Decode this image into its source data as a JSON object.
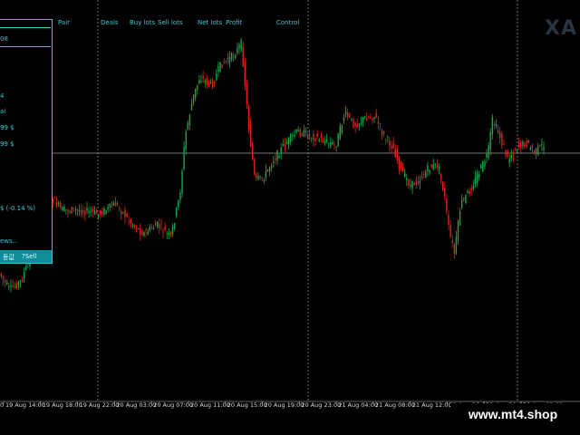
{
  "chart": {
    "symbol_partial": "XA",
    "time_axis": [
      "19 Aug 14:00",
      "19 Aug 18:00",
      "19 Aug 22:00",
      "20 Aug 03:00",
      "20 Aug 07:00",
      "20 Aug 11:00",
      "20 Aug 15:00",
      "20 Aug 19:00",
      "20 Aug 23:00",
      "21 Aug 04:00",
      "21 Aug 08:00",
      "21 Aug 12:00",
      "21 Aug 16:00",
      "21 Aug 20:00",
      "22 Aug 01:00"
    ],
    "first_axis_label_partial": "0",
    "colors": {
      "bull": "#19a84a",
      "bear": "#e0231f",
      "grid": "#8a8a8a",
      "panel": "#38c7d6"
    }
  },
  "panel": {
    "headers": [
      "Pair",
      "Deals",
      "Buy lots",
      "Sell lots",
      "Net lots",
      "Profit",
      "Control"
    ],
    "rows": [
      "08",
      "",
      "4",
      "ai",
      "99 $",
      "99 $",
      "$ (-0.14 %)",
      "ews..."
    ],
    "buttons": [
      "동값",
      "?Sell"
    ]
  },
  "watermark": "www.mt4.shop"
}
